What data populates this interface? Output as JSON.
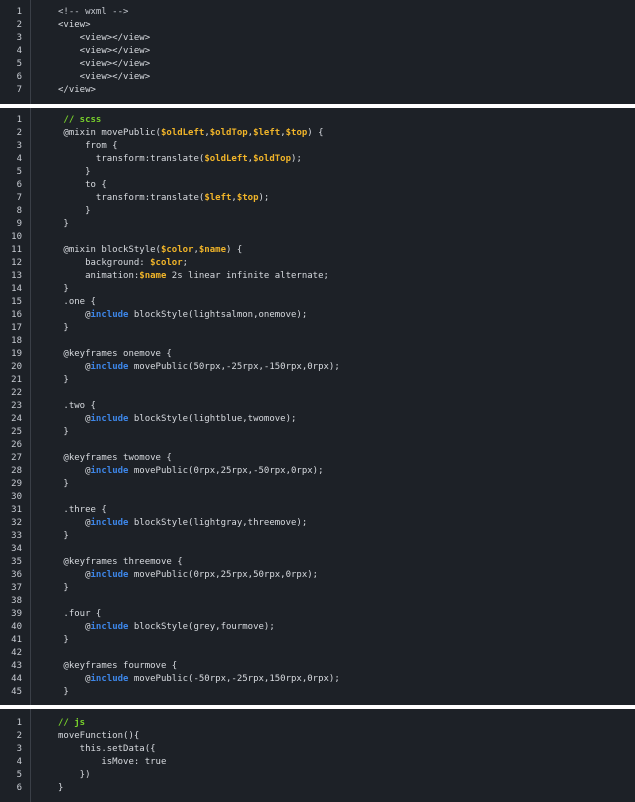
{
  "colors": {
    "background": "#1d2127",
    "comment": "#78d12b",
    "variable": "#f0b429",
    "keyword": "#3d86e8",
    "text": "#d7dadf"
  },
  "blocks": [
    {
      "name": "wxml",
      "lines": [
        [
          {
            "t": "<!-- wxml -->",
            "c": "muted"
          }
        ],
        [
          {
            "t": "<view>",
            "c": "plain"
          }
        ],
        [
          {
            "t": "    <view></view>",
            "c": "plain"
          }
        ],
        [
          {
            "t": "    <view></view>",
            "c": "plain"
          }
        ],
        [
          {
            "t": "    <view></view>",
            "c": "plain"
          }
        ],
        [
          {
            "t": "    <view></view>",
            "c": "plain"
          }
        ],
        [
          {
            "t": "</view>",
            "c": "plain"
          }
        ]
      ]
    },
    {
      "name": "scss",
      "lines": [
        [
          {
            "t": " // scss",
            "c": "comment"
          }
        ],
        [
          {
            "t": " @mixin movePublic(",
            "c": "plain"
          },
          {
            "t": "$oldLeft",
            "c": "orange"
          },
          {
            "t": ",",
            "c": "plain"
          },
          {
            "t": "$oldTop",
            "c": "orange"
          },
          {
            "t": ",",
            "c": "plain"
          },
          {
            "t": "$left",
            "c": "orange"
          },
          {
            "t": ",",
            "c": "plain"
          },
          {
            "t": "$top",
            "c": "orange"
          },
          {
            "t": ") {",
            "c": "plain"
          }
        ],
        [
          {
            "t": "     from {",
            "c": "plain"
          }
        ],
        [
          {
            "t": "       transform:translate(",
            "c": "plain"
          },
          {
            "t": "$oldLeft",
            "c": "orange"
          },
          {
            "t": ",",
            "c": "plain"
          },
          {
            "t": "$oldTop",
            "c": "orange"
          },
          {
            "t": ");",
            "c": "plain"
          }
        ],
        [
          {
            "t": "     }",
            "c": "plain"
          }
        ],
        [
          {
            "t": "     to {",
            "c": "plain"
          }
        ],
        [
          {
            "t": "       transform:translate(",
            "c": "plain"
          },
          {
            "t": "$left",
            "c": "orange"
          },
          {
            "t": ",",
            "c": "plain"
          },
          {
            "t": "$top",
            "c": "orange"
          },
          {
            "t": ");",
            "c": "plain"
          }
        ],
        [
          {
            "t": "     }",
            "c": "plain"
          }
        ],
        [
          {
            "t": " }",
            "c": "plain"
          }
        ],
        [],
        [
          {
            "t": " @mixin blockStyle(",
            "c": "plain"
          },
          {
            "t": "$color",
            "c": "orange"
          },
          {
            "t": ",",
            "c": "plain"
          },
          {
            "t": "$name",
            "c": "orange"
          },
          {
            "t": ") {",
            "c": "plain"
          }
        ],
        [
          {
            "t": "     background: ",
            "c": "plain"
          },
          {
            "t": "$color",
            "c": "orange"
          },
          {
            "t": ";",
            "c": "plain"
          }
        ],
        [
          {
            "t": "     animation:",
            "c": "plain"
          },
          {
            "t": "$name",
            "c": "orange"
          },
          {
            "t": " 2s linear infinite alternate;",
            "c": "plain"
          }
        ],
        [
          {
            "t": " }",
            "c": "plain"
          }
        ],
        [
          {
            "t": " .one {",
            "c": "plain"
          }
        ],
        [
          {
            "t": "     @",
            "c": "plain"
          },
          {
            "t": "include",
            "c": "blue"
          },
          {
            "t": " blockStyle(lightsalmon,onemove);",
            "c": "plain"
          }
        ],
        [
          {
            "t": " }",
            "c": "plain"
          }
        ],
        [],
        [
          {
            "t": " @keyframes onemove {",
            "c": "plain"
          }
        ],
        [
          {
            "t": "     @",
            "c": "plain"
          },
          {
            "t": "include",
            "c": "blue"
          },
          {
            "t": " movePublic(50rpx,-25rpx,-150rpx,0rpx);",
            "c": "plain"
          }
        ],
        [
          {
            "t": " }",
            "c": "plain"
          }
        ],
        [],
        [
          {
            "t": " .two {",
            "c": "plain"
          }
        ],
        [
          {
            "t": "     @",
            "c": "plain"
          },
          {
            "t": "include",
            "c": "blue"
          },
          {
            "t": " blockStyle(lightblue,twomove);",
            "c": "plain"
          }
        ],
        [
          {
            "t": " }",
            "c": "plain"
          }
        ],
        [],
        [
          {
            "t": " @keyframes twomove {",
            "c": "plain"
          }
        ],
        [
          {
            "t": "     @",
            "c": "plain"
          },
          {
            "t": "include",
            "c": "blue"
          },
          {
            "t": " movePublic(0rpx,25rpx,-50rpx,0rpx);",
            "c": "plain"
          }
        ],
        [
          {
            "t": " }",
            "c": "plain"
          }
        ],
        [],
        [
          {
            "t": " .three {",
            "c": "plain"
          }
        ],
        [
          {
            "t": "     @",
            "c": "plain"
          },
          {
            "t": "include",
            "c": "blue"
          },
          {
            "t": " blockStyle(lightgray,threemove);",
            "c": "plain"
          }
        ],
        [
          {
            "t": " }",
            "c": "plain"
          }
        ],
        [],
        [
          {
            "t": " @keyframes threemove {",
            "c": "plain"
          }
        ],
        [
          {
            "t": "     @",
            "c": "plain"
          },
          {
            "t": "include",
            "c": "blue"
          },
          {
            "t": " movePublic(0rpx,25rpx,50rpx,0rpx);",
            "c": "plain"
          }
        ],
        [
          {
            "t": " }",
            "c": "plain"
          }
        ],
        [],
        [
          {
            "t": " .four {",
            "c": "plain"
          }
        ],
        [
          {
            "t": "     @",
            "c": "plain"
          },
          {
            "t": "include",
            "c": "blue"
          },
          {
            "t": " blockStyle(grey,fourmove);",
            "c": "plain"
          }
        ],
        [
          {
            "t": " }",
            "c": "plain"
          }
        ],
        [],
        [
          {
            "t": " @keyframes fourmove {",
            "c": "plain"
          }
        ],
        [
          {
            "t": "     @",
            "c": "plain"
          },
          {
            "t": "include",
            "c": "blue"
          },
          {
            "t": " movePublic(-50rpx,-25rpx,150rpx,0rpx);",
            "c": "plain"
          }
        ],
        [
          {
            "t": " }",
            "c": "plain"
          }
        ]
      ]
    },
    {
      "name": "js",
      "lines": [
        [
          {
            "t": "// js",
            "c": "comment"
          }
        ],
        [
          {
            "t": "moveFunction(){",
            "c": "plain"
          }
        ],
        [
          {
            "t": "    this.setData({",
            "c": "plain"
          }
        ],
        [
          {
            "t": "        isMove: true",
            "c": "plain"
          }
        ],
        [
          {
            "t": "    })",
            "c": "plain"
          }
        ],
        [
          {
            "t": "}",
            "c": "plain"
          }
        ]
      ]
    }
  ]
}
